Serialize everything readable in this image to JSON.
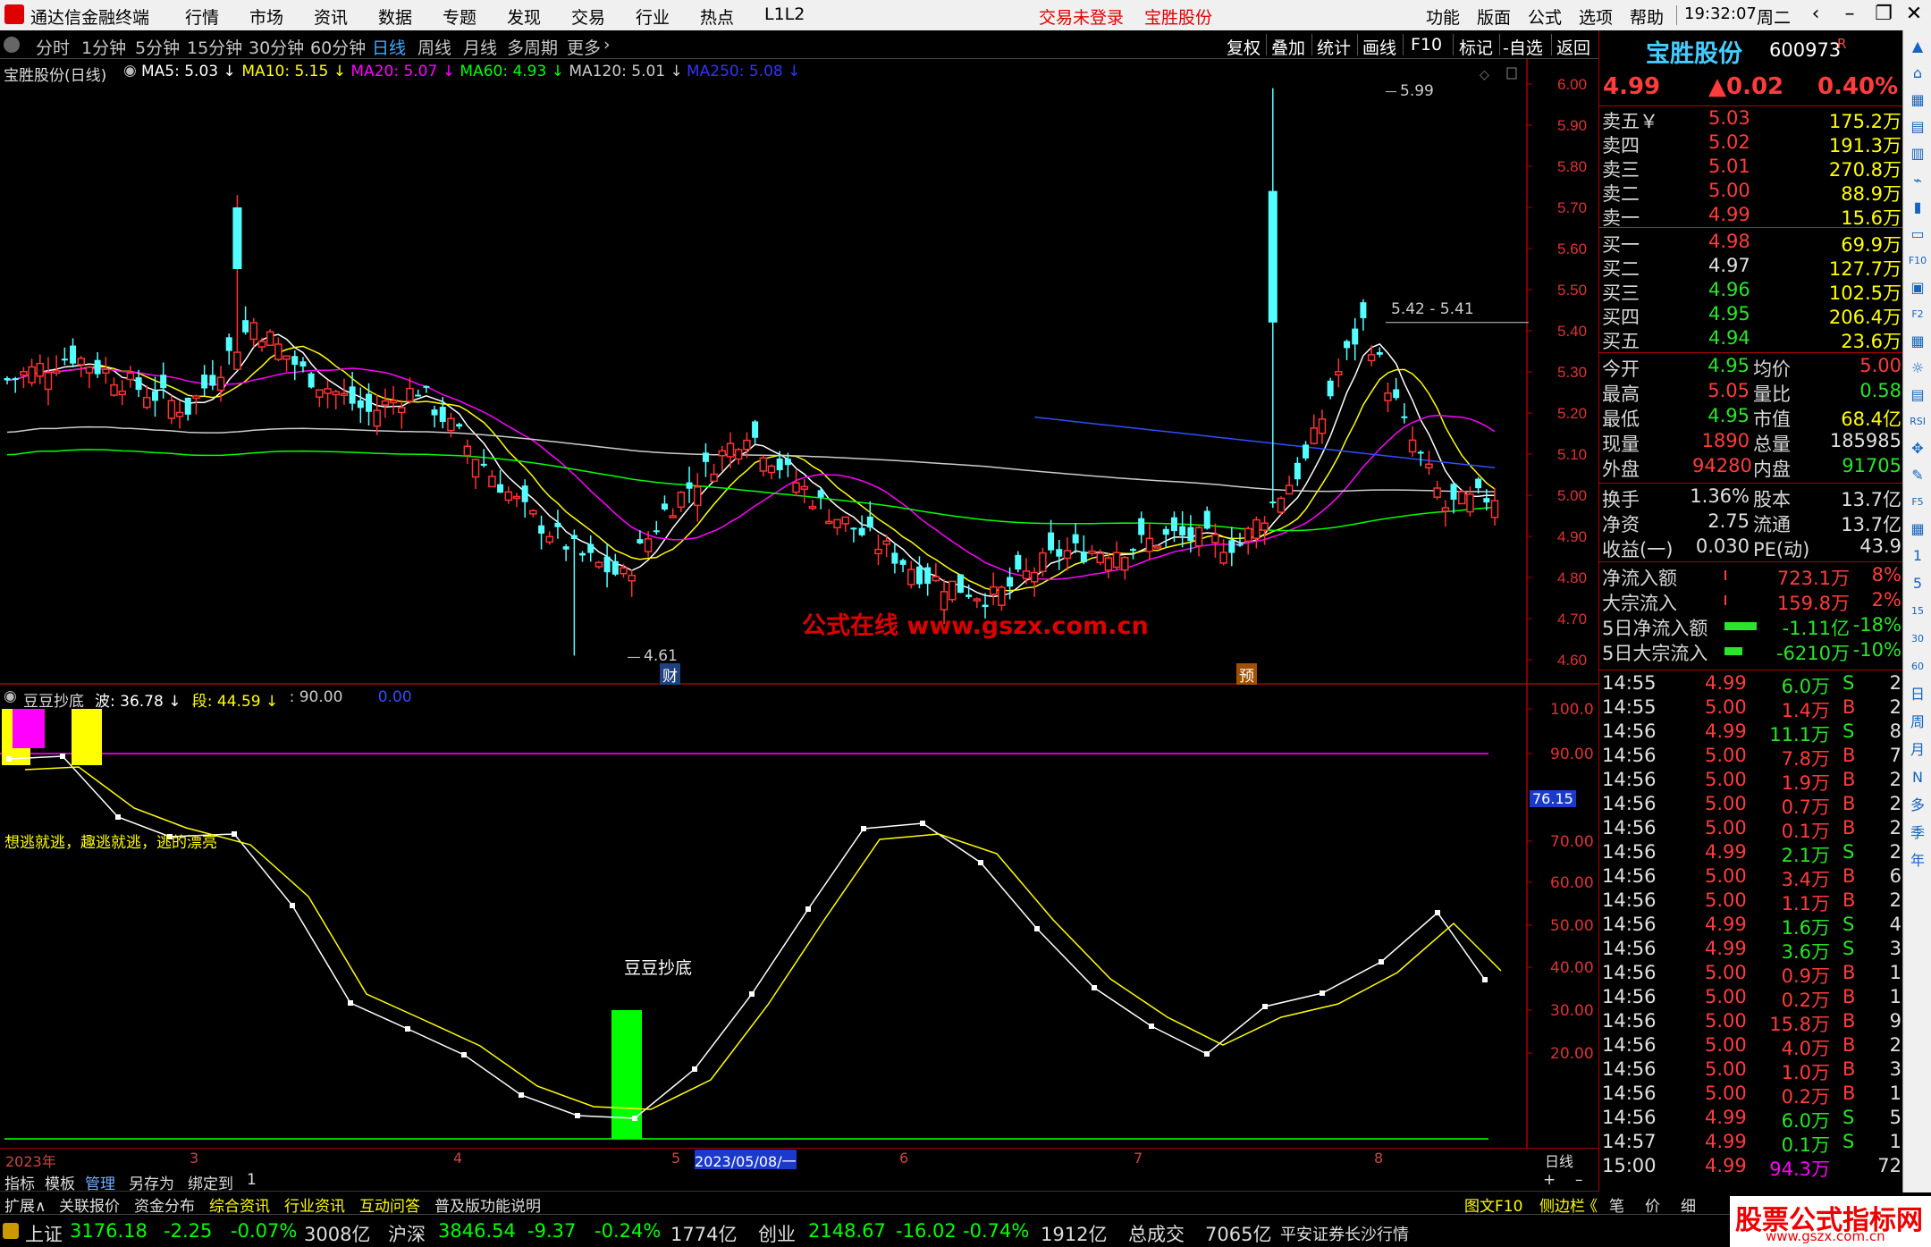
{
  "menubar": {
    "app_title": "通达信金融终端",
    "menus": [
      "行情",
      "市场",
      "资讯",
      "数据",
      "专题",
      "发现",
      "交易",
      "行业",
      "热点",
      "L1L2"
    ],
    "trade_status": "交易未登录",
    "stock_name": "宝胜股份",
    "right_menus": [
      "功能",
      "版面",
      "公式",
      "选项",
      "帮助"
    ],
    "time": "19:32:07",
    "weekday": "周二"
  },
  "periods": [
    "分时",
    "1分钟",
    "5分钟",
    "15分钟",
    "30分钟",
    "60分钟",
    "日线",
    "周线",
    "月线",
    "多周期",
    "更多"
  ],
  "active_period": "日线",
  "toolbar": [
    "复权",
    "叠加",
    "统计",
    "画线",
    "F10",
    "标记",
    "-自选",
    "返回"
  ],
  "main_chart": {
    "title": "宝胜股份(日线)",
    "ma": [
      {
        "label": "MA5: 5.03",
        "color": "#ffffff"
      },
      {
        "label": "MA10: 5.15",
        "color": "#ffff00"
      },
      {
        "label": "MA20: 5.07",
        "color": "#ff00ff"
      },
      {
        "label": "MA60: 4.93",
        "color": "#00ff00"
      },
      {
        "label": "MA120: 5.01",
        "color": "#cccccc"
      },
      {
        "label": "MA250: 5.08",
        "color": "#3333ff"
      }
    ],
    "price_ticks": [
      "6.00",
      "5.90",
      "5.80",
      "5.70",
      "5.60",
      "5.50",
      "5.40",
      "5.30",
      "5.20",
      "5.10",
      "5.00",
      "4.90",
      "4.80",
      "4.70",
      "4.60"
    ],
    "high_label": "5.99",
    "range_label": "5.42 - 5.41",
    "low_label": "4.61",
    "marker_cai": "财",
    "marker_yu": "预",
    "watermark": "公式在线 www.gszx.com.cn"
  },
  "indicator": {
    "title": "豆豆抄底",
    "params": [
      {
        "label": "波: 36.78",
        "color": "#ffffff"
      },
      {
        "label": "段: 44.59",
        "color": "#ffff00"
      },
      {
        "label": ": 90.00",
        "color": "#cccccc"
      },
      {
        "label": "0.00",
        "color": "#2f4fff"
      }
    ],
    "ticks": [
      "100.0",
      "90.00",
      "70.00",
      "60.00",
      "50.00",
      "40.00",
      "30.00",
      "20.00"
    ],
    "current_value": "76.15",
    "note": "想逃就逃，趣逃就逃，逃的漂亮",
    "bottom_label": "豆豆抄底"
  },
  "date_axis": {
    "labels": [
      "2023年",
      "3",
      "4",
      "5",
      "6",
      "7",
      "8"
    ],
    "highlight": "2023/05/08/一",
    "period_label": "日线"
  },
  "bottom_tabs": [
    "指标",
    "模板",
    "管理",
    "另存为",
    "绑定到",
    "1"
  ],
  "bottom_tabs2": [
    "扩展∧",
    "关联报价",
    "资金分布",
    "综合资讯",
    "行业资讯",
    "互动问答",
    "普及版功能说明"
  ],
  "right_tabs2": [
    "图文F10",
    "侧边栏",
    "《",
    "笔",
    "价",
    "细"
  ],
  "status": {
    "items": [
      {
        "name": "上证",
        "price": "3176.18",
        "chg": "-2.25",
        "pct": "-0.07%",
        "vol": "3008亿"
      },
      {
        "name": "沪深",
        "price": "3846.54",
        "chg": "-9.37",
        "pct": "-0.24%",
        "vol": "1774亿"
      },
      {
        "name": "创业",
        "price": "2148.67",
        "chg": "-16.02",
        "pct": "-0.74%",
        "vol": "1912亿"
      }
    ],
    "total_label": "总成交",
    "total": "7065亿",
    "broker": "平安证券长沙行情"
  },
  "quote": {
    "name": "宝胜股份",
    "code": "600973",
    "flag": "R",
    "price": "4.99",
    "change": "▲0.02",
    "pct": "0.40%",
    "asks": [
      {
        "label": "卖五￥",
        "price": "5.03",
        "vol": "175.2万"
      },
      {
        "label": "卖四",
        "price": "5.02",
        "vol": "191.3万"
      },
      {
        "label": "卖三",
        "price": "5.01",
        "vol": "270.8万"
      },
      {
        "label": "卖二",
        "price": "5.00",
        "vol": "88.9万"
      },
      {
        "label": "卖一",
        "price": "4.99",
        "vol": "15.6万"
      }
    ],
    "bids": [
      {
        "label": "买一",
        "price": "4.98",
        "vol": "69.9万"
      },
      {
        "label": "买二",
        "price": "4.97",
        "vol": "127.7万"
      },
      {
        "label": "买三",
        "price": "4.96",
        "vol": "102.5万"
      },
      {
        "label": "买四",
        "price": "4.95",
        "vol": "206.4万"
      },
      {
        "label": "买五",
        "price": "4.94",
        "vol": "23.6万"
      }
    ],
    "stats": [
      {
        "l1": "今开",
        "v1": "4.95",
        "l2": "均价",
        "v2": "5.00"
      },
      {
        "l1": "最高",
        "v1": "5.05",
        "l2": "量比",
        "v2": "0.58"
      },
      {
        "l1": "最低",
        "v1": "4.95",
        "l2": "市值",
        "v2": "68.4亿"
      },
      {
        "l1": "现量",
        "v1": "1890",
        "l2": "总量",
        "v2": "185985"
      },
      {
        "l1": "外盘",
        "v1": "94280",
        "l2": "内盘",
        "v2": "91705"
      }
    ],
    "stats2": [
      {
        "l1": "换手",
        "v1": "1.36%",
        "l2": "股本",
        "v2": "13.7亿"
      },
      {
        "l1": "净资",
        "v1": "2.75",
        "l2": "流通",
        "v2": "13.7亿"
      },
      {
        "l1": "收益(一)",
        "v1": "0.030",
        "l2": "PE(动)",
        "v2": "43.9"
      }
    ],
    "flows": [
      {
        "label": "净流入额",
        "value": "723.1万",
        "pct": "8%"
      },
      {
        "label": "大宗流入",
        "value": "159.8万",
        "pct": "2%"
      },
      {
        "label": "5日净流入额",
        "value": "-1.11亿",
        "pct": "-18%"
      },
      {
        "label": "5日大宗流入",
        "value": "-6210万",
        "pct": "-10%"
      }
    ],
    "ticks": [
      {
        "t": "14:55",
        "p": "4.99",
        "v": "6.0万",
        "d": "S",
        "n": "2"
      },
      {
        "t": "14:55",
        "p": "5.00",
        "v": "1.4万",
        "d": "B",
        "n": "2"
      },
      {
        "t": "14:56",
        "p": "4.99",
        "v": "11.1万",
        "d": "S",
        "n": "8"
      },
      {
        "t": "14:56",
        "p": "5.00",
        "v": "7.8万",
        "d": "B",
        "n": "7"
      },
      {
        "t": "14:56",
        "p": "5.00",
        "v": "1.9万",
        "d": "B",
        "n": "2"
      },
      {
        "t": "14:56",
        "p": "5.00",
        "v": "0.7万",
        "d": "B",
        "n": "2"
      },
      {
        "t": "14:56",
        "p": "5.00",
        "v": "0.1万",
        "d": "B",
        "n": "2"
      },
      {
        "t": "14:56",
        "p": "4.99",
        "v": "2.1万",
        "d": "S",
        "n": "2"
      },
      {
        "t": "14:56",
        "p": "5.00",
        "v": "3.4万",
        "d": "B",
        "n": "6"
      },
      {
        "t": "14:56",
        "p": "5.00",
        "v": "1.1万",
        "d": "B",
        "n": "2"
      },
      {
        "t": "14:56",
        "p": "4.99",
        "v": "1.6万",
        "d": "S",
        "n": "4"
      },
      {
        "t": "14:56",
        "p": "4.99",
        "v": "3.6万",
        "d": "S",
        "n": "3"
      },
      {
        "t": "14:56",
        "p": "5.00",
        "v": "0.9万",
        "d": "B",
        "n": "1"
      },
      {
        "t": "14:56",
        "p": "5.00",
        "v": "0.2万",
        "d": "B",
        "n": "1"
      },
      {
        "t": "14:56",
        "p": "5.00",
        "v": "15.8万",
        "d": "B",
        "n": "9"
      },
      {
        "t": "14:56",
        "p": "5.00",
        "v": "4.0万",
        "d": "B",
        "n": "2"
      },
      {
        "t": "14:56",
        "p": "5.00",
        "v": "1.0万",
        "d": "B",
        "n": "3"
      },
      {
        "t": "14:56",
        "p": "5.00",
        "v": "0.2万",
        "d": "B",
        "n": "1"
      },
      {
        "t": "14:56",
        "p": "4.99",
        "v": "6.0万",
        "d": "S",
        "n": "5"
      },
      {
        "t": "14:57",
        "p": "4.99",
        "v": "0.1万",
        "d": "S",
        "n": "1"
      },
      {
        "t": "15:00",
        "p": "4.99",
        "v": "94.3万",
        "d": "",
        "n": "72"
      }
    ]
  },
  "sidebar": [
    "▲",
    "⌂",
    "▦",
    "▤",
    "▥",
    "⌁",
    "▮",
    "▭",
    "F10",
    "▣",
    "F2",
    "▦",
    "☼",
    "▤",
    "RSI",
    "✥",
    "✎",
    "F5",
    "▦",
    "1",
    "5",
    "15",
    "30",
    "60",
    "日",
    "周",
    "月",
    "N",
    "多",
    "季",
    "年"
  ],
  "logo": {
    "title": "股票公式指标网",
    "url": "www.gszx.com.cn"
  }
}
